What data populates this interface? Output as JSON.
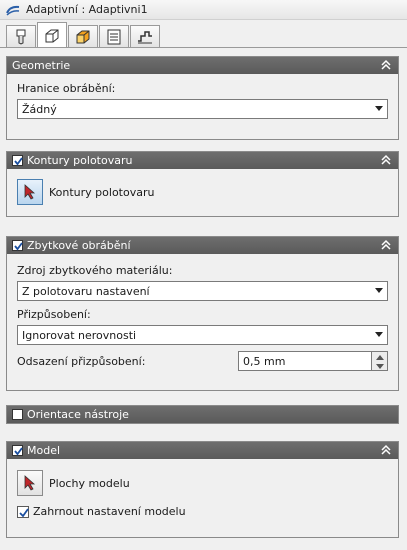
{
  "window": {
    "title": "Adaptivní : Adaptivni1"
  },
  "tabs": [
    {
      "icon": "tool-icon"
    },
    {
      "icon": "shape-icon"
    },
    {
      "icon": "heights-icon"
    },
    {
      "icon": "passes-icon"
    },
    {
      "icon": "linking-icon"
    }
  ],
  "geometry": {
    "header": "Geometrie",
    "boundary_label": "Hranice obrábění:",
    "boundary_value": "Žádný"
  },
  "stock_contours": {
    "header": "Kontury polotovaru",
    "checked": true,
    "pick_label": "Kontury polotovaru"
  },
  "rest_machining": {
    "header": "Zbytkové obrábění",
    "checked": true,
    "source_label": "Zdroj zbytkového materiálu:",
    "source_value": "Z polotovaru nastavení",
    "adjust_label": "Přizpůsobení:",
    "adjust_value": "Ignorovat nerovnosti",
    "offset_label": "Odsazení přizpůsobení:",
    "offset_value": "0,5 mm"
  },
  "tool_orientation": {
    "header": "Orientace nástroje",
    "checked": false
  },
  "model": {
    "header": "Model",
    "checked": true,
    "pick_label": "Plochy modelu",
    "include_setup_label": "Zahrnout nastavení modelu",
    "include_setup_checked": true
  },
  "colors": {
    "header_bg": "#626262",
    "pick_active": "#b9d5ee",
    "cursor_red": "#c0262a"
  }
}
